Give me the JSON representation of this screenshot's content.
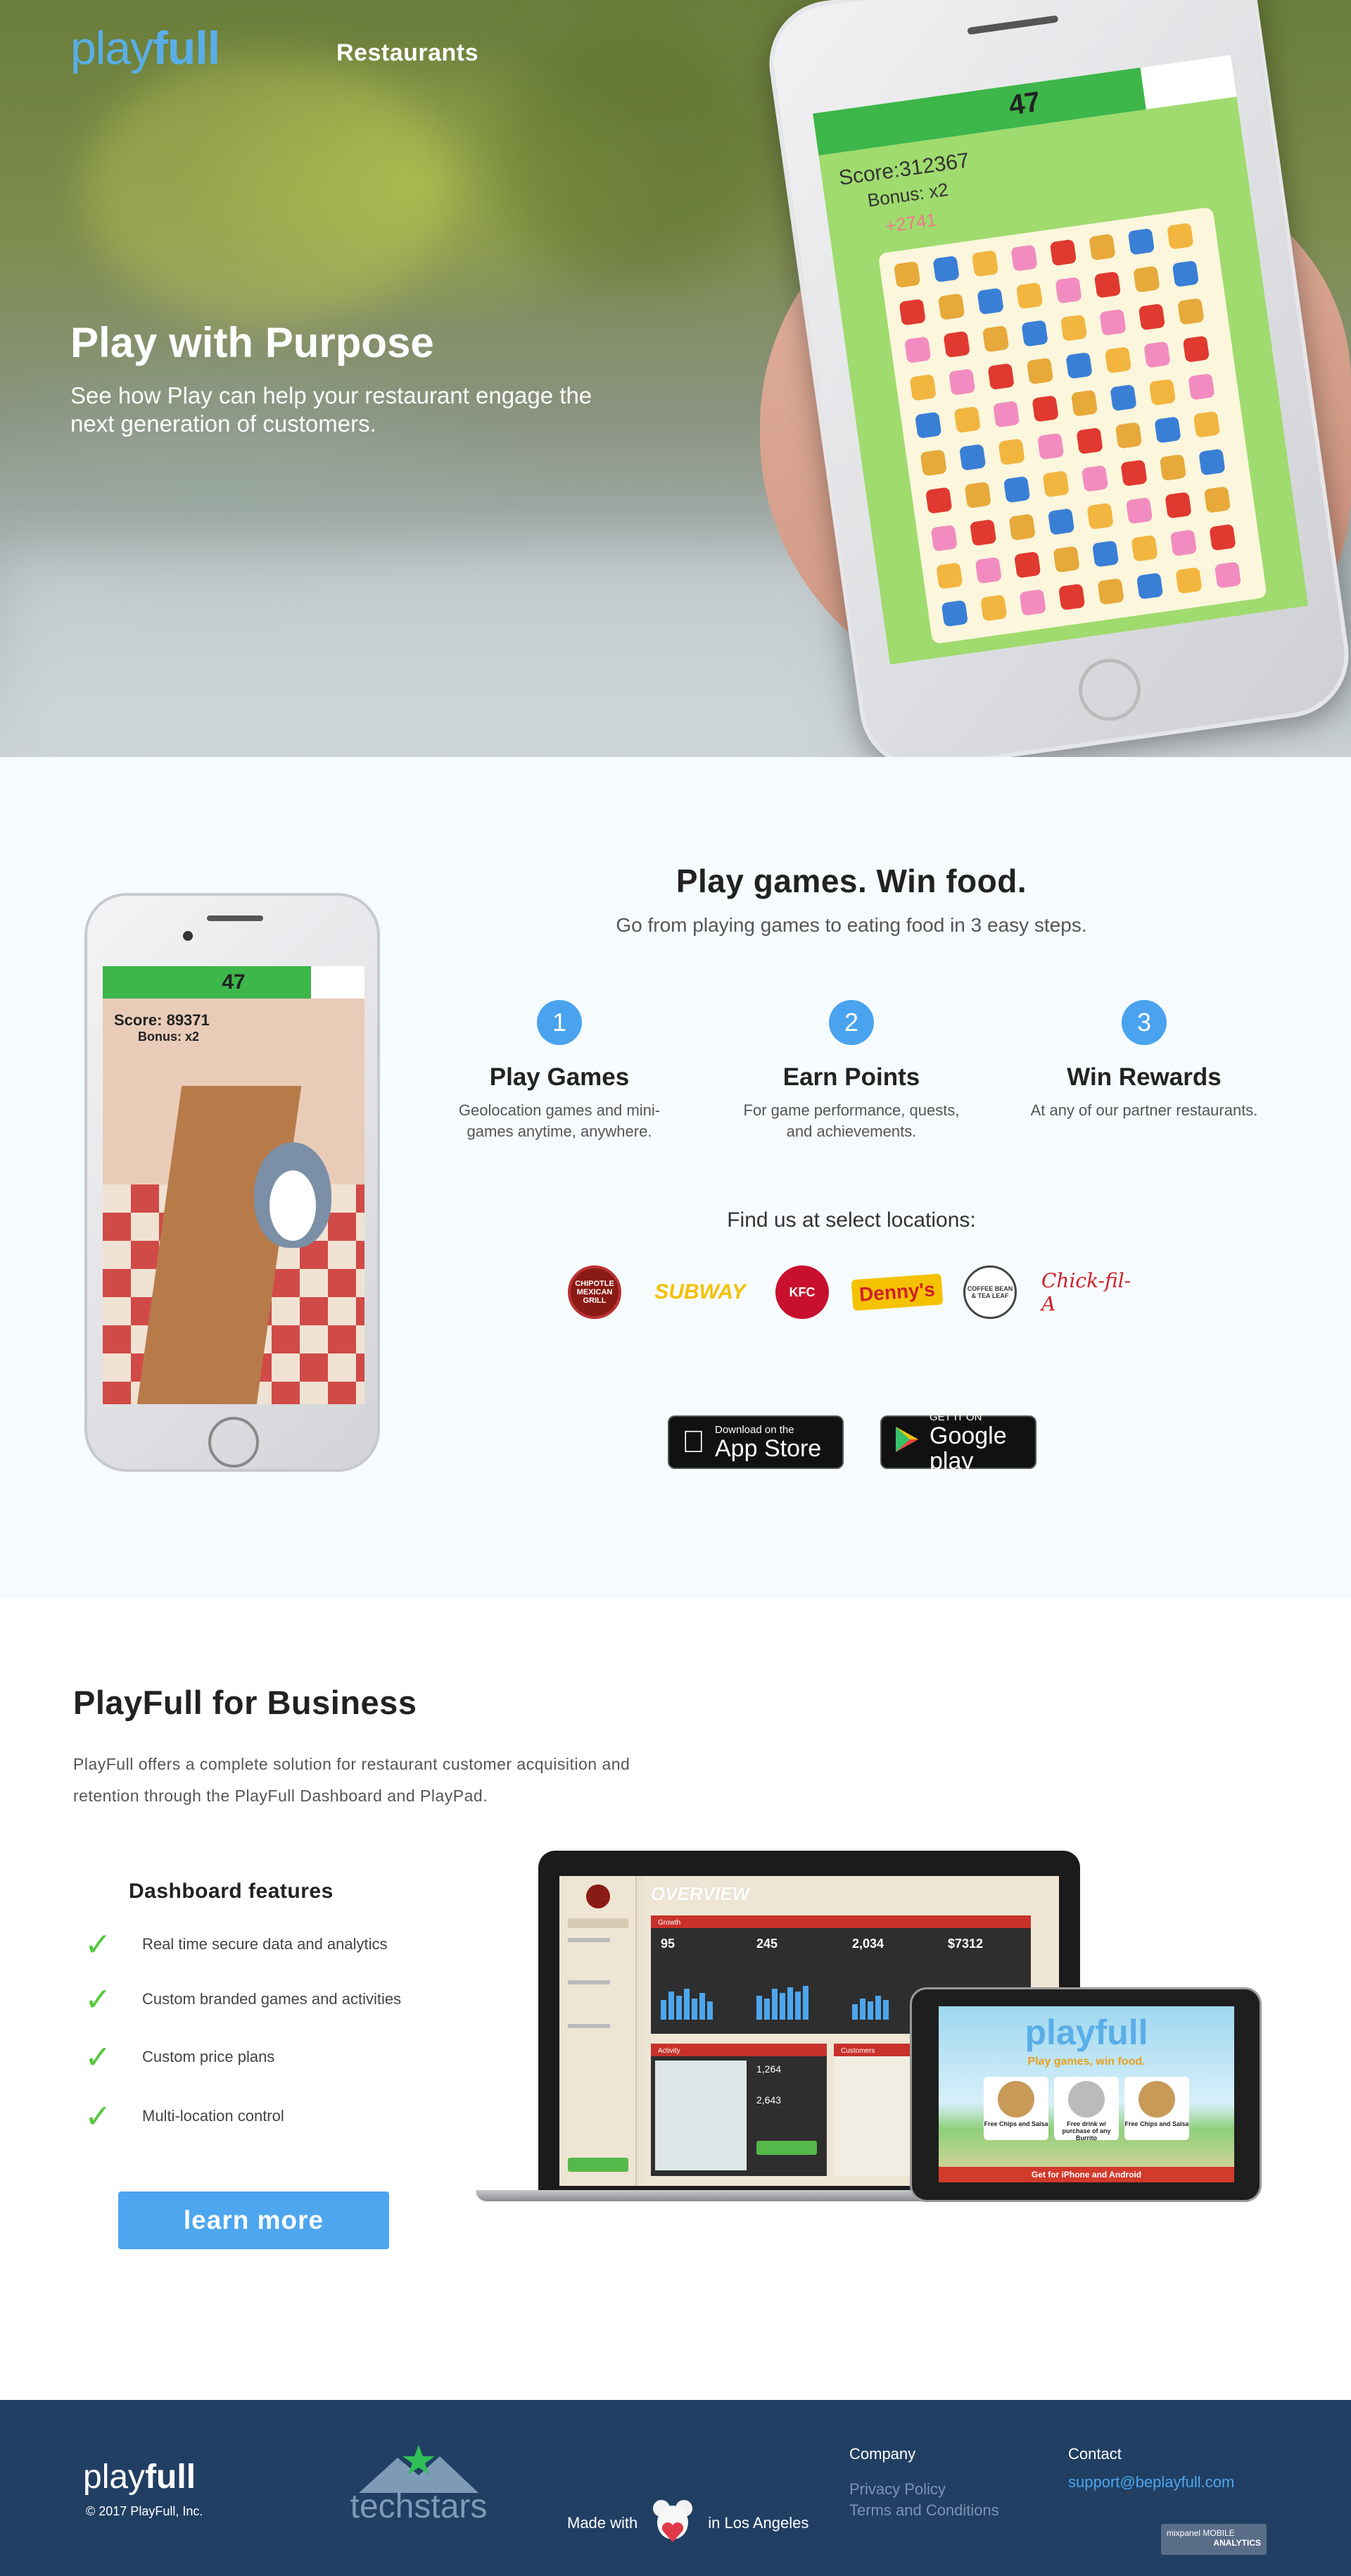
{
  "header": {
    "logo_play": "play",
    "logo_full": "full",
    "nav_label": "Restaurants"
  },
  "hero": {
    "title": "Play with Purpose",
    "subtitle": "See how Play can help your restaurant engage the next generation of customers.",
    "phone": {
      "timer": "47",
      "score": "Score:312367",
      "bonus": "Bonus: x2",
      "points": "+2741"
    }
  },
  "how": {
    "title": "Play games. Win food.",
    "subtitle": "Go from playing games to eating food in 3 easy steps.",
    "phone": {
      "timer": "47",
      "score": "Score: 89371",
      "bonus": "Bonus: x2"
    },
    "steps": [
      {
        "num": "1",
        "label": "Play Games",
        "desc": "Geolocation games and mini-games anytime, anywhere."
      },
      {
        "num": "2",
        "label": "Earn Points",
        "desc": "For game performance, quests, and achievements."
      },
      {
        "num": "3",
        "label": "Win Rewards",
        "desc": "At any of our partner restaurants."
      }
    ],
    "locations_label": "Find us at select locations:",
    "brands": [
      "CHIPOTLE MEXICAN GRILL",
      "SUBWAY",
      "KFC",
      "Denny's",
      "COFFEE BEAN & TEA LEAF",
      "Chick-fil-A"
    ],
    "app_store": {
      "small": "Download on the",
      "big": "App Store"
    },
    "google_play": {
      "small": "GET IT ON",
      "big": "Google play"
    }
  },
  "business": {
    "title": "PlayFull for Business",
    "description": "PlayFull offers a complete solution for restaurant customer acquisition and retention through the PlayFull Dashboard and PlayPad.",
    "features_title": "Dashboard features",
    "features": [
      "Real time secure data and analytics",
      "Custom branded games and activities",
      "Custom price plans",
      "Multi-location control"
    ],
    "cta_label": "learn more",
    "dashboard": {
      "heading": "OVERVIEW",
      "growth_label": "Growth",
      "stats": [
        "95",
        "245",
        "2,034",
        "$7312"
      ],
      "activity_label": "Activity",
      "customers_label": "Customers",
      "new_customers": "1,264",
      "visits": "2,643"
    },
    "tablet": {
      "logo": "playfull",
      "tagline": "Play games, win food.",
      "cards": [
        "Free Chips and Salsa",
        "Free drink w/ purchase of any Burrito",
        "Free Chips and Salsa"
      ],
      "footer": "Get for iPhone and Android"
    }
  },
  "footer": {
    "logo_play": "play",
    "logo_full": "full",
    "copyright": "© 2017 PlayFull, Inc.",
    "techstars": "techstars",
    "made_with": "Made with",
    "in_la": "in Los Angeles",
    "company_heading": "Company",
    "company_links": [
      "Privacy Policy",
      "Terms and Conditions"
    ],
    "contact_heading": "Contact",
    "contact_email": "support@beplayfull.com",
    "badge_line1": "mixpanel MOBILE",
    "badge_line2": "ANALYTICS"
  }
}
